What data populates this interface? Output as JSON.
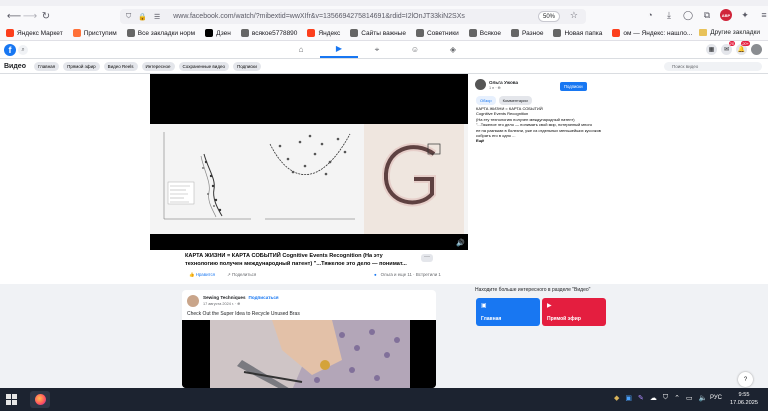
{
  "browser": {
    "url": "www.facebook.com/watch/?mibextid=wwXIfr&v=1356694275814691&rdid=I2lOnJT33kiN2SXs",
    "zoom": "50%",
    "abp_label": "ABP"
  },
  "bookmarks": [
    {
      "label": "Яндекс Маркет",
      "color": "#fc3f1d"
    },
    {
      "label": "Приступим",
      "color": "#ff7139"
    },
    {
      "label": "Все закладки норм",
      "color": "#666666"
    },
    {
      "label": "Дзен",
      "color": "#000000"
    },
    {
      "label": "всякое5778890",
      "color": "#666666"
    },
    {
      "label": "Яндекс",
      "color": "#fc3f1d"
    },
    {
      "label": "Сайты важные",
      "color": "#666666"
    },
    {
      "label": "Советники",
      "color": "#666666"
    },
    {
      "label": "Всякое",
      "color": "#666666"
    },
    {
      "label": "Разное",
      "color": "#666666"
    },
    {
      "label": "Новая папка",
      "color": "#666666"
    },
    {
      "label": "ом — Яндекс: нашло...",
      "color": "#fc3f1d"
    }
  ],
  "bookmarks_other": "Другие закладки",
  "fb": {
    "logo": "f",
    "badges": {
      "messages": "20",
      "notifications": "20+"
    }
  },
  "video_header": {
    "title": "Видео",
    "tabs": [
      "Главная",
      "Прямой эфир",
      "Видео Reels",
      "Интересное",
      "Сохраненные видео",
      "Подписки"
    ],
    "search_placeholder": "Поиск видео"
  },
  "post": {
    "title": "КАРТА ЖИЗНИ = КАРТА СОБЫТИЙ Cognitive Events Recognition (На эту технологию получен международный патент) \"...Тяжелое это дело — понимат...",
    "like_label": "Нравится",
    "share_label": "Поделиться",
    "stats": "Ольга и еще 11 · Встретили 1"
  },
  "side": {
    "author_name": "Ольга Ужова",
    "author_date": "1 н · ⊕",
    "subscribe_label": "Подписки",
    "tabs": [
      "Обзор",
      "Комментарии"
    ],
    "description_lines": [
      "КАРТА ЖИЗНИ = КАРТА СОБЫТИЙ",
      "Cognitive Events Recognition",
      "(На эту технологию получен международный патент)",
      "\"...Тяжелое это дело — понимать свой мир, потерянный много",
      "ее на разными в болезни, уже из отдельных меньшейших кусочков",
      "собрать его в одно ...",
      "Ещё"
    ]
  },
  "feed_post": {
    "author": "Sewing Techniques",
    "follow_label": "Подписаться",
    "date": "17 августа 2024 г. · ⊕",
    "title": "Check Out the Super Idea to Recycle Unused Bras"
  },
  "feed_side": {
    "title": "Находите больше интересного в разделе \"Видео\"",
    "tiles": [
      {
        "label": "Главная",
        "color": "#1877f2"
      },
      {
        "label": "Прямой эфир",
        "color": "#e41e3f"
      }
    ]
  },
  "taskbar": {
    "language": "РУС",
    "time": "9:55",
    "date": "17.06.2025"
  }
}
